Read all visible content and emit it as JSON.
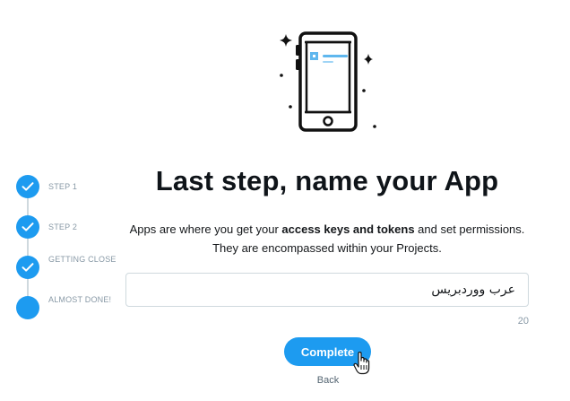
{
  "stepper": {
    "steps": [
      {
        "label": "STEP 1",
        "status": "done"
      },
      {
        "label": "STEP 2",
        "status": "done"
      },
      {
        "label": "GETTING CLOSE",
        "status": "done"
      },
      {
        "label": "ALMOST DONE!",
        "status": "current"
      }
    ]
  },
  "main": {
    "heading": "Last step, name your App",
    "desc_part1": "Apps are where you get your ",
    "desc_bold": "access keys and tokens",
    "desc_part2": " and set permissions. They are encompassed within your Projects.",
    "app_name_value": "عرب ووردبريس",
    "char_count": "20",
    "complete_label": "Complete",
    "back_label": "Back"
  },
  "colors": {
    "accent": "#1d9bf0",
    "text": "#0f1419",
    "muted": "#8899a6",
    "border": "#cfd9de"
  },
  "icons": [
    "check-icon",
    "phone-illustration",
    "sparkle-icon",
    "hand-cursor-icon"
  ]
}
